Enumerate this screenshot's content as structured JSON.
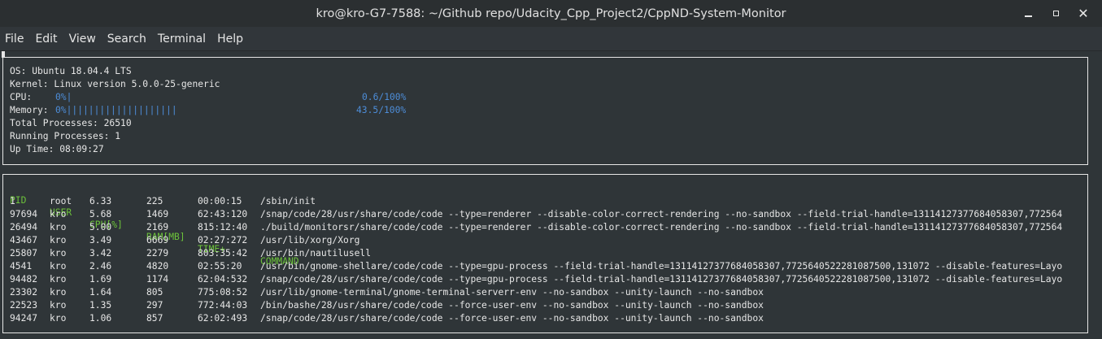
{
  "window": {
    "title": "kro@kro-G7-7588: ~/Github repo/Udacity_Cpp_Project2/CppND-System-Monitor"
  },
  "menu": [
    "File",
    "Edit",
    "View",
    "Search",
    "Terminal",
    "Help"
  ],
  "system": {
    "os": "OS: Ubuntu 18.04.4 LTS",
    "kernel": "Kernel: Linux version 5.0.0-25-generic",
    "cpu_label": "CPU:",
    "cpu_bar": "0%|",
    "cpu_value": "0.6/100%",
    "cpu_fraction": 0.006,
    "memory_label": "Memory:",
    "memory_bar": "0%||||||||||||||||||||",
    "memory_value": "43.5/100%",
    "memory_fraction": 0.435,
    "total_processes": "Total Processes: 26510",
    "running_processes": "Running Processes: 1",
    "uptime": "Up Time: 08:09:27"
  },
  "process_table": {
    "headers": [
      "PID",
      "USER",
      "CPU[%]",
      "RAM[MB]",
      "TIME+",
      "COMMAND"
    ],
    "rows": [
      [
        "1",
        "root",
        "6.33",
        "225",
        "00:00:15",
        "/sbin/init"
      ],
      [
        "97694",
        "kro",
        "5.68",
        "1469",
        "62:43:120",
        "/snap/code/28/usr/share/code/code --type=renderer --disable-color-correct-rendering --no-sandbox --field-trial-handle=13114127377684058307,772564"
      ],
      [
        "26494",
        "kro",
        "5.00",
        "2169",
        "815:12:40",
        "./build/monitorsr/share/code/code --type=renderer --disable-color-correct-rendering --no-sandbox --field-trial-handle=13114127377684058307,772564"
      ],
      [
        "43467",
        "kro",
        "3.49",
        "6669",
        "02:27:272",
        "/usr/lib/xorg/Xorg"
      ],
      [
        "25807",
        "kro",
        "3.42",
        "2279",
        "803:35:42",
        "/usr/bin/nautilusell"
      ],
      [
        "4541",
        "kro",
        "2.46",
        "4820",
        "02:55:20",
        "/usr/bin/gnome-shellare/code/code --type=gpu-process --field-trial-handle=13114127377684058307,7725640522281087500,131072 --disable-features=Layo"
      ],
      [
        "94482",
        "kro",
        "1.69",
        "1174",
        "62:04:532",
        "/snap/code/28/usr/share/code/code --type=gpu-process --field-trial-handle=13114127377684058307,7725640522281087500,131072 --disable-features=Layo"
      ],
      [
        "23302",
        "kro",
        "1.64",
        "805",
        "775:08:52",
        "/usr/lib/gnome-terminal/gnome-terminal-serverr-env --no-sandbox --unity-launch --no-sandbox"
      ],
      [
        "22523",
        "kro",
        "1.35",
        "297",
        "772:44:03",
        "/bin/bashe/28/usr/share/code/code --force-user-env --no-sandbox --unity-launch --no-sandbox"
      ],
      [
        "94247",
        "kro",
        "1.06",
        "857",
        "62:02:493",
        "/snap/code/28/usr/share/code/code --force-user-env --no-sandbox --unity-launch --no-sandbox"
      ]
    ]
  }
}
